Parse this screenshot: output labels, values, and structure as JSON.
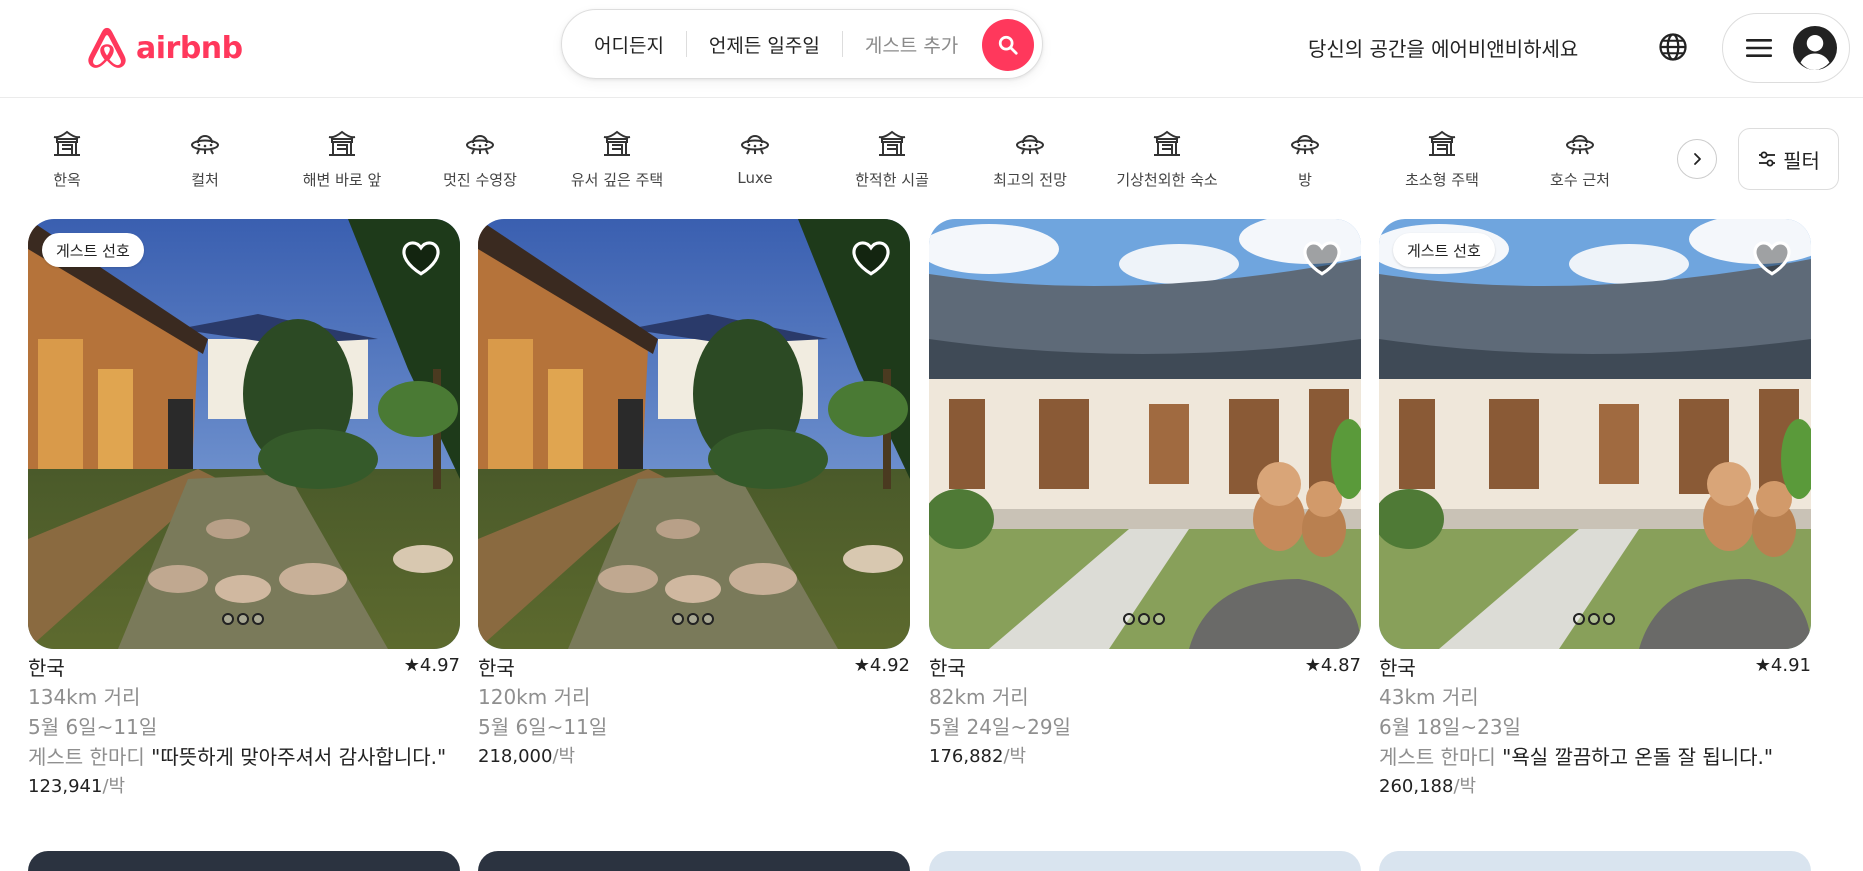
{
  "brand": {
    "logo_text": "airbnb",
    "accent": "#ff385c"
  },
  "search": {
    "where": "어디든지",
    "when": "언제든 일주일",
    "guests": "게스트 추가"
  },
  "header": {
    "host_link": "당신의 공간을 에어비앤비하세요"
  },
  "categories": [
    {
      "label": "한옥",
      "icon": "hanok-icon"
    },
    {
      "label": "컬처",
      "icon": "ufo-icon"
    },
    {
      "label": "해변 바로 앞",
      "icon": "hanok-icon"
    },
    {
      "label": "멋진 수영장",
      "icon": "ufo-icon"
    },
    {
      "label": "유서 깊은 주택",
      "icon": "hanok-icon"
    },
    {
      "label": "Luxe",
      "icon": "ufo-icon"
    },
    {
      "label": "한적한 시골",
      "icon": "hanok-icon"
    },
    {
      "label": "최고의 전망",
      "icon": "ufo-icon"
    },
    {
      "label": "기상천외한 숙소",
      "icon": "hanok-icon"
    },
    {
      "label": "방",
      "icon": "ufo-icon"
    },
    {
      "label": "초소형 주택",
      "icon": "hanok-icon"
    },
    {
      "label": "호수 근처",
      "icon": "ufo-icon"
    }
  ],
  "filter": {
    "label": "필터"
  },
  "listings": [
    {
      "badge": "게스트 선호",
      "title": "한국",
      "rating": "★4.97",
      "distance": "134km 거리",
      "dates": "5월 6일~11일",
      "review_lead": "게스트 한마디",
      "review_text": " \"따뜻하게 맞아주셔서 감사합니다.\"",
      "price": "123,941",
      "price_unit": "/박",
      "scene": "night"
    },
    {
      "badge": "",
      "title": "한국",
      "rating": "★4.92",
      "distance": "120km 거리",
      "dates": "5월 6일~11일",
      "review_lead": "",
      "review_text": "",
      "price": "218,000",
      "price_unit": "/박",
      "scene": "night"
    },
    {
      "badge": "",
      "title": "한국",
      "rating": "★4.87",
      "distance": "82km 거리",
      "dates": "5월 24일~29일",
      "review_lead": "",
      "review_text": "",
      "price": "176,882",
      "price_unit": "/박",
      "scene": "day"
    },
    {
      "badge": "게스트 선호",
      "title": "한국",
      "rating": "★4.91",
      "distance": "43km 거리",
      "dates": "6월 18일~23일",
      "review_lead": "게스트 한마디",
      "review_text": " \"욕실 깔끔하고 온돌 잘 됩니다.\"",
      "price": "260,188",
      "price_unit": "/박",
      "scene": "day"
    }
  ]
}
